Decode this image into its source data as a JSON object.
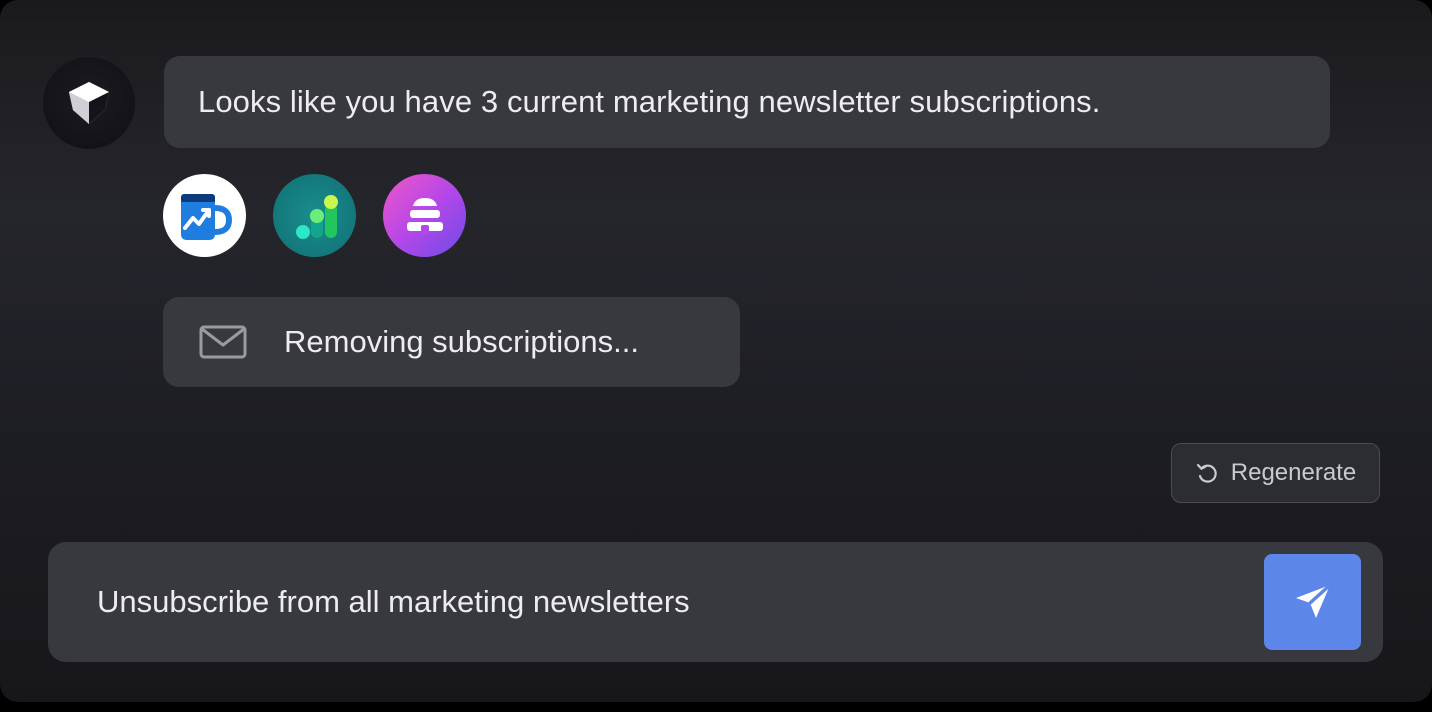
{
  "assistant": {
    "avatar_icon": "cube-logo-icon",
    "message": "Looks like you have 3 current marketing newsletter subscriptions."
  },
  "subscriptions": [
    {
      "icon": "coffee-mug-chart-icon",
      "color": "#ffffff"
    },
    {
      "icon": "bar-chart-dots-icon",
      "color": "#12797c"
    },
    {
      "icon": "beehive-icon",
      "color": "#b547e8"
    }
  ],
  "status": {
    "icon": "mail-icon",
    "text": "Removing subscriptions..."
  },
  "actions": {
    "regenerate_icon": "refresh-icon",
    "regenerate_label": "Regenerate"
  },
  "composer": {
    "value": "Unsubscribe from all marketing newsletters",
    "send_icon": "send-icon",
    "send_color": "#5d86ea"
  }
}
